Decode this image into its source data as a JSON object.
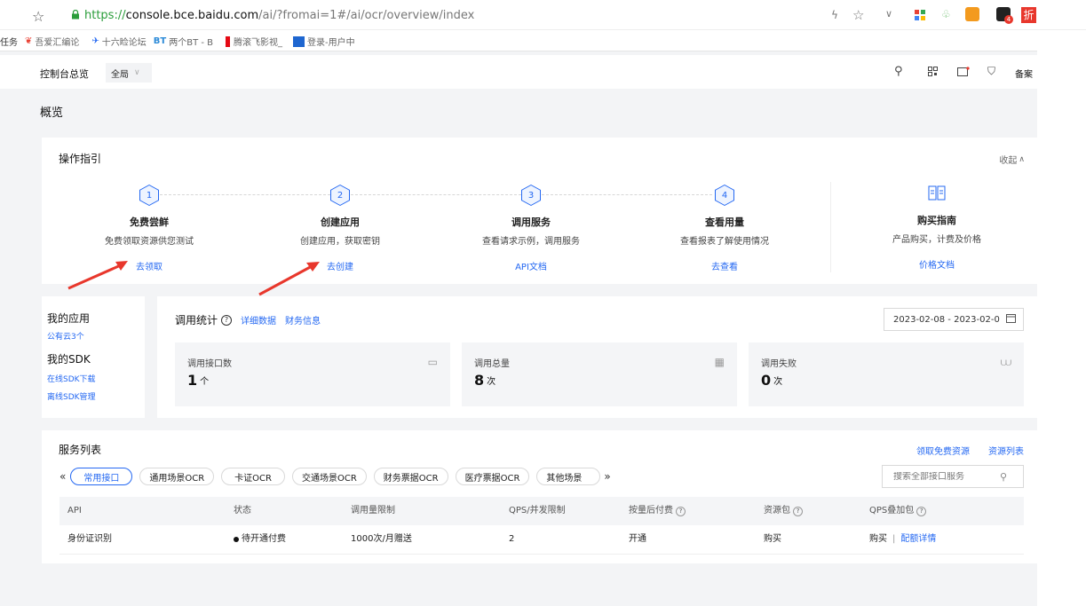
{
  "browser": {
    "url_prefix": "https://",
    "url_host": "console.bce.baidu.com",
    "url_path": "/ai/?fromai=1#/ai/ocr/overview/index",
    "bookmarks": [
      {
        "label": "任务"
      },
      {
        "label": "吾爱汇编论"
      },
      {
        "label": "十六睑论坛"
      },
      {
        "label": "两个BT - B"
      },
      {
        "label": "腾滚飞影视_"
      },
      {
        "label": "登录-用户中"
      }
    ],
    "ext_badge": "4",
    "ext_red_label": "折"
  },
  "console": {
    "title": "控制台总览",
    "region": "全局",
    "filing": "备案"
  },
  "page_title": "概览",
  "guide": {
    "title": "操作指引",
    "collapse": "收起",
    "steps": [
      {
        "num": "1",
        "title": "免费尝鲜",
        "desc": "免费领取资源供您测试",
        "link": "去领取"
      },
      {
        "num": "2",
        "title": "创建应用",
        "desc": "创建应用，获取密钥",
        "link": "去创建"
      },
      {
        "num": "3",
        "title": "调用服务",
        "desc": "查看请求示例，调用服务",
        "link": "API文档"
      },
      {
        "num": "4",
        "title": "查看用量",
        "desc": "查看报表了解使用情况",
        "link": "去查看"
      }
    ],
    "purchase": {
      "title": "购买指南",
      "desc": "产品购买，计费及价格",
      "link": "价格文档"
    }
  },
  "side": {
    "my_apps": "我的应用",
    "public_cloud": "公有云3个",
    "my_sdk": "我的SDK",
    "online_sdk": "在线SDK下载",
    "offline_sdk": "离线SDK管理"
  },
  "stats": {
    "title": "调用统计",
    "detail_link": "详细数据",
    "finance_link": "财务信息",
    "date_range": "2023-02-08 - 2023-02-0",
    "cards": [
      {
        "label": "调用接口数",
        "value": "1",
        "unit": "个"
      },
      {
        "label": "调用总量",
        "value": "8",
        "unit": "次"
      },
      {
        "label": "调用失败",
        "value": "0",
        "unit": "次"
      }
    ]
  },
  "services": {
    "title": "服务列表",
    "free_link": "领取免费资源",
    "resource_link": "资源列表",
    "tabs": [
      "常用接口",
      "通用场景OCR",
      "卡证OCR",
      "交通场景OCR",
      "财务票据OCR",
      "医疗票据OCR",
      "其他场景"
    ],
    "search_placeholder": "搜索全部接口服务",
    "columns": [
      "API",
      "状态",
      "调用量限制",
      "QPS/并发限制",
      "按量后付费",
      "资源包",
      "QPS叠加包"
    ],
    "rows": [
      {
        "api": "身份证识别",
        "status": "待开通付费",
        "limit": "1000次/月赠送",
        "qps": "2",
        "postpay": "开通",
        "package": "购买",
        "qps_buy": "购买",
        "qps_detail": "配额详情"
      }
    ]
  },
  "colors": {
    "accent": "#2468f2",
    "arrow": "#e8372c"
  }
}
